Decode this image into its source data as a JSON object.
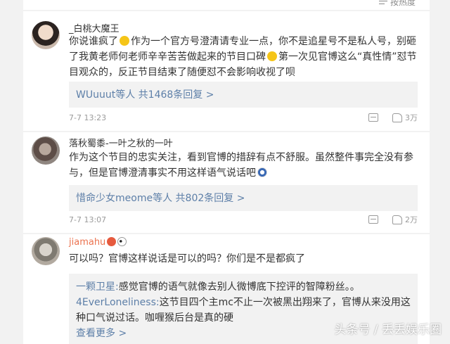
{
  "sort": {
    "label": "按热度"
  },
  "comments": [
    {
      "name": "_白桃大魔王",
      "text_a": "你说谁疯了",
      "text_b": "作为一个官方号澄清请专业一点，你不是追星号不是私人号，别砸了我黄老师何老师辛辛苦苦做起来的节目口碑",
      "text_c": "第一次见官博这么“真性情”怼节目观众的，反正节目结束了随便怼不会影响收视了呗",
      "reply_users": "WUuuut等人",
      "reply_count": "共1468条回复 >",
      "time": "7-7 13:23",
      "likes": "3万"
    },
    {
      "name": "落秋蜀黍-一叶之秋的一叶",
      "text": "作为这个节目的忠实关注，看到官博的措辞有点不舒服。虽然整件事完全没有参与，但是官博澄清事实不用这样语气说话吧",
      "reply_users": "惜命少女meome等人",
      "reply_count": "共802条回复 >",
      "time": "7-7 13:07",
      "likes": "2万"
    },
    {
      "name": "jiamahu",
      "text": "可以吗？官博这样说话是可以的吗？你们是不是都疯了",
      "replies": [
        {
          "user": "一颗卫星:",
          "text": "感觉官博的语气就像去别人微博底下控评的智障粉丝。。"
        },
        {
          "user": "4EverLoneliness:",
          "text": "这节目四个主mc不止一次被黑出翔来了，官博从来没用这种口气说过话。咖喱猴后台是真的硬"
        }
      ],
      "more": "查看更多 >"
    }
  ],
  "watermark": "头条号 / 丢丢娱乐圈"
}
